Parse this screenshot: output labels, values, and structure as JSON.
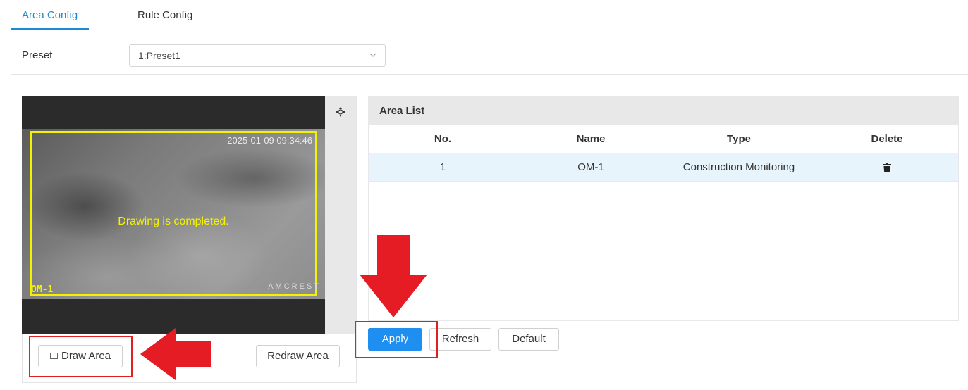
{
  "tabs": [
    {
      "label": "Area Config",
      "active": true
    },
    {
      "label": "Rule Config",
      "active": false
    }
  ],
  "preset": {
    "label": "Preset",
    "value": "1:Preset1"
  },
  "video": {
    "timestamp": "2025-01-09 09:34:46",
    "status_message": "Drawing is completed.",
    "roi_label": "OM-1",
    "watermark": "AMCREST",
    "roi_color": "#f3f300"
  },
  "draw_controls": {
    "draw_area_label": "Draw Area",
    "redraw_area_label": "Redraw Area"
  },
  "area_list": {
    "title": "Area List",
    "columns": [
      "No.",
      "Name",
      "Type",
      "Delete"
    ],
    "rows": [
      {
        "no": "1",
        "name": "OM-1",
        "type": "Construction Monitoring"
      }
    ]
  },
  "actions": {
    "apply_label": "Apply",
    "refresh_label": "Refresh",
    "default_label": "Default"
  },
  "colors": {
    "accent": "#1c8ad4",
    "primary_button": "#1f8ef1",
    "annotation_red": "#e02020"
  }
}
